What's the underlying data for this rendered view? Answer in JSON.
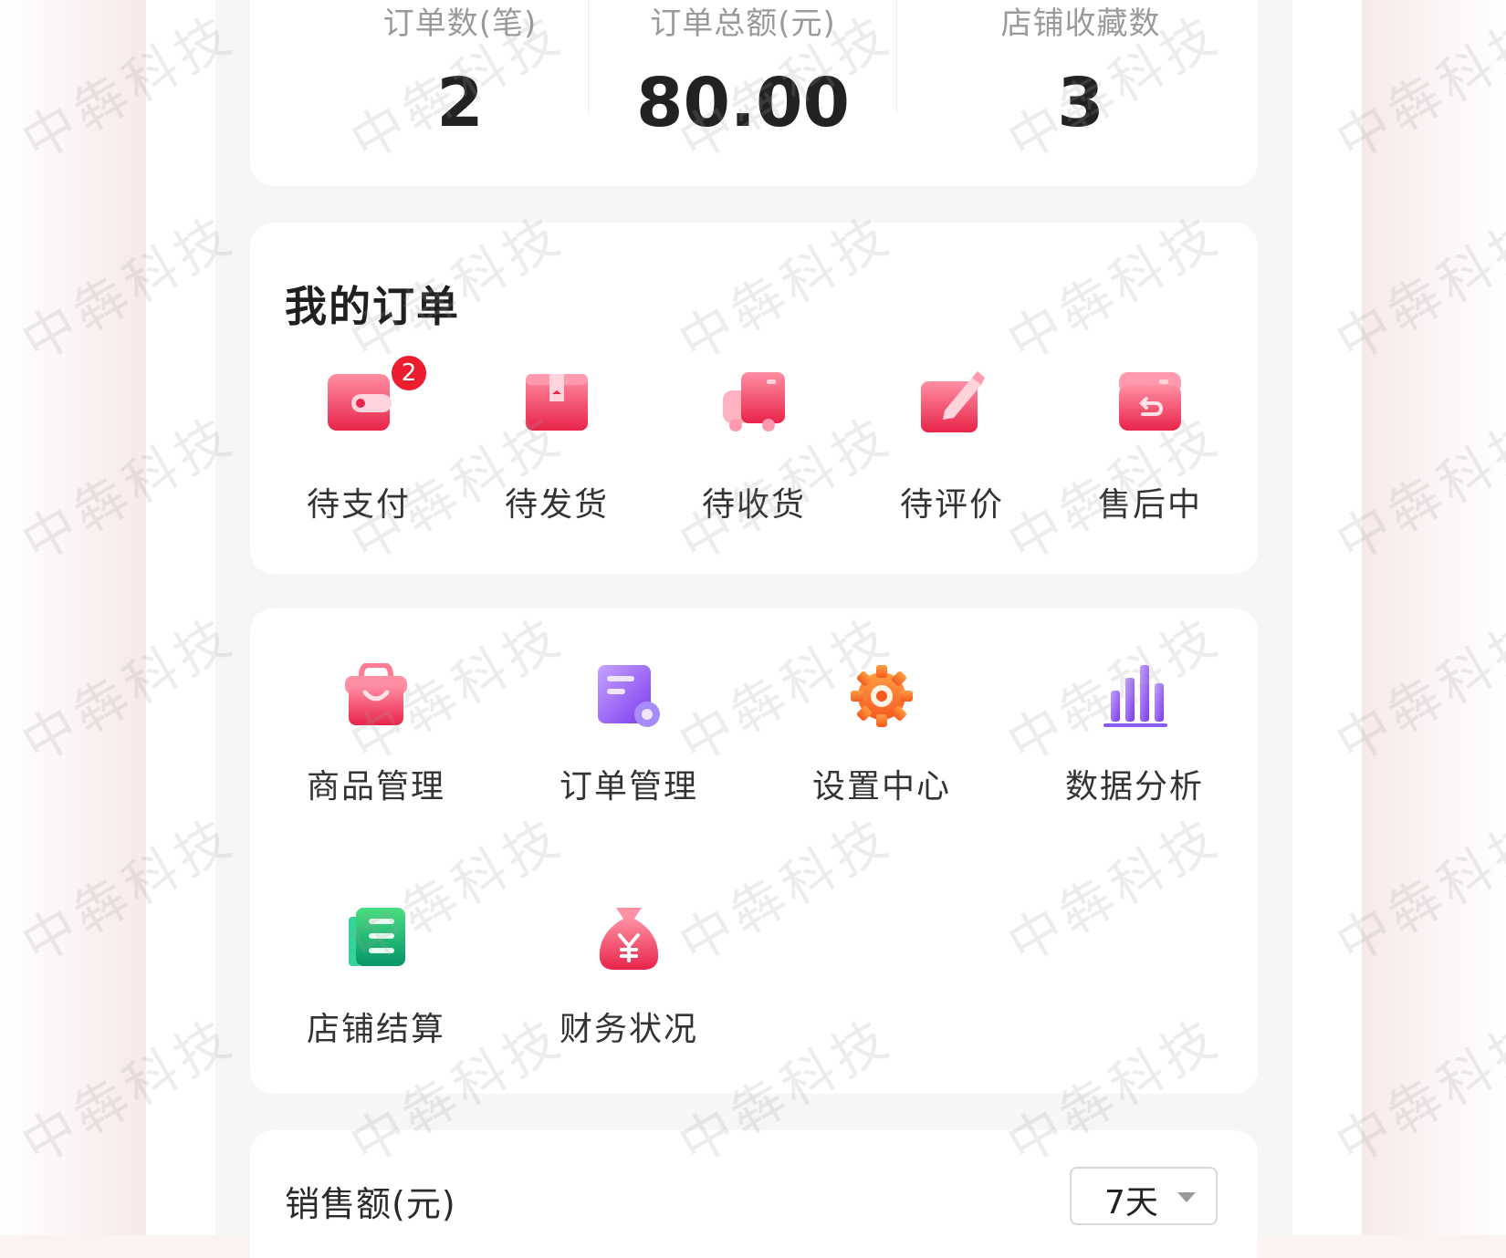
{
  "stats": [
    {
      "label": "订单数(笔)",
      "value": "2"
    },
    {
      "label": "订单总额(元)",
      "value": "80.00"
    },
    {
      "label": "店铺收藏数",
      "value": "3"
    }
  ],
  "orders": {
    "title": "我的订单",
    "items": [
      {
        "label": "待支付",
        "icon": "wallet-icon",
        "badge": "2"
      },
      {
        "label": "待发货",
        "icon": "package-icon"
      },
      {
        "label": "待收货",
        "icon": "truck-icon"
      },
      {
        "label": "待评价",
        "icon": "edit-icon"
      },
      {
        "label": "售后中",
        "icon": "return-box-icon"
      }
    ]
  },
  "tools": {
    "items": [
      {
        "label": "商品管理",
        "icon": "shopping-bag-icon"
      },
      {
        "label": "订单管理",
        "icon": "order-settings-icon"
      },
      {
        "label": "设置中心",
        "icon": "gear-icon"
      },
      {
        "label": "数据分析",
        "icon": "bar-chart-icon"
      },
      {
        "label": "店铺结算",
        "icon": "ledger-icon"
      },
      {
        "label": "财务状况",
        "icon": "money-bag-icon"
      }
    ]
  },
  "sales": {
    "title": "销售额(元)",
    "range": "7天"
  },
  "watermark": "中犇科技",
  "colors": {
    "accent_red": "#ec1d2f",
    "pink_gradient_start": "#ff8fa3",
    "pink_gradient_end": "#e8244a",
    "purple": "#8b5cf6",
    "orange": "#f97316",
    "green": "#10b981"
  }
}
